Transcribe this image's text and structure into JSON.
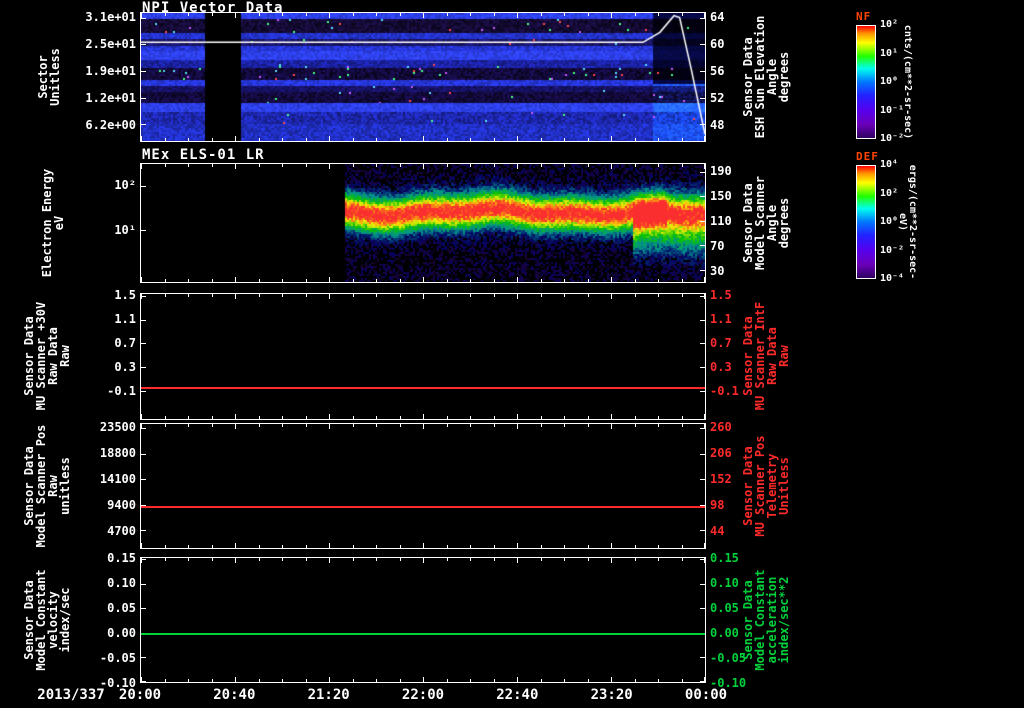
{
  "meta": {
    "background": "#000000",
    "axis_color": "#ffffff",
    "red": "#ff2a2a",
    "green": "#00d23c"
  },
  "xaxis": {
    "date_label": "2013/337",
    "tick_labels": [
      "20:00",
      "20:40",
      "21:20",
      "22:00",
      "22:40",
      "23:20",
      "00:00"
    ]
  },
  "panels": [
    {
      "title": "NPI Vector Data",
      "left_label": "Sector\nUnitless",
      "right_label": "Sensor Data\nESH Sun Elevation\nAngle\ndegrees",
      "right_color": "#ffffff",
      "left_ticks": {
        "labels": [
          "3.1e+01",
          "2.5e+01",
          "1.9e+01",
          "1.2e+01",
          "6.2e+00"
        ],
        "fracs": [
          0.038,
          0.246,
          0.454,
          0.662,
          0.869
        ]
      },
      "right_ticks": {
        "labels": [
          "64",
          "60",
          "56",
          "52",
          "48"
        ],
        "fracs": [
          0.038,
          0.246,
          0.454,
          0.662,
          0.869
        ]
      }
    },
    {
      "title": "MEx ELS-01 LR",
      "left_label": "Electron Energy\neV",
      "right_label": "Sensor Data\nModel Scanner\nAngle\ndegrees",
      "right_color": "#ffffff",
      "left_ticks": {
        "labels": [
          "10²",
          "10¹"
        ],
        "fracs": [
          0.183,
          0.558
        ]
      },
      "right_ticks": {
        "labels": [
          "190",
          "150",
          "110",
          "70",
          "30"
        ],
        "fracs": [
          0.067,
          0.275,
          0.483,
          0.69,
          0.9
        ]
      }
    },
    {
      "title": "",
      "left_label": "Sensor Data\nMU Scanner +30V\nRaw Data\nRaw",
      "right_label": "Sensor Data\nMU Scanner IntF\nRaw Data\nRaw",
      "right_color": "#ff2a2a",
      "left_ticks": {
        "labels": [
          "1.5",
          "1.1",
          "0.7",
          "0.3",
          "-0.1"
        ],
        "fracs": [
          0.016,
          0.205,
          0.394,
          0.583,
          0.772
        ]
      },
      "right_ticks": {
        "labels": [
          "1.5",
          "1.1",
          "0.7",
          "0.3",
          "-0.1"
        ],
        "fracs": [
          0.016,
          0.205,
          0.394,
          0.583,
          0.772
        ]
      }
    },
    {
      "title": "",
      "left_label": "Sensor Data\nModel Scanner Pos\nRaw\nunitless",
      "right_label": "Sensor Data\nMU Scanner Pos\nTelemetry\nUnitless",
      "right_color": "#ff2a2a",
      "left_ticks": {
        "labels": [
          "23500",
          "18800",
          "14100",
          "9400",
          "4700"
        ],
        "fracs": [
          0.032,
          0.238,
          0.444,
          0.65,
          0.856
        ]
      },
      "right_ticks": {
        "labels": [
          "260",
          "206",
          "152",
          "98",
          "44"
        ],
        "fracs": [
          0.032,
          0.238,
          0.444,
          0.65,
          0.856
        ]
      }
    },
    {
      "title": "",
      "left_label": "Sensor Data\nModel Constant\nvelocity\nindex/sec",
      "right_label": "Sensor Data\nModel Constant\nacceleration\nindex/sec**2",
      "right_color": "#00d23c",
      "left_ticks": {
        "labels": [
          "0.15",
          "0.10",
          "0.05",
          "0.00",
          "-0.05",
          "-0.10"
        ],
        "fracs": [
          0.008,
          0.206,
          0.405,
          0.603,
          0.802,
          1.0
        ]
      },
      "right_ticks": {
        "labels": [
          "0.15",
          "0.10",
          "0.05",
          "0.00",
          "-0.05",
          "-0.10"
        ],
        "fracs": [
          0.008,
          0.206,
          0.405,
          0.603,
          0.802,
          1.0
        ]
      }
    }
  ],
  "colorbars": [
    {
      "title": "NF",
      "title_color": "#ff4400",
      "unit": "cnts/(cm**2-sr-sec)",
      "tick_labels": [
        "10²",
        "10¹",
        "10⁰",
        "10⁻¹",
        "10⁻²"
      ],
      "tick_fracs": [
        0,
        0.25,
        0.5,
        0.75,
        1
      ]
    },
    {
      "title": "DEF",
      "title_color": "#ff4400",
      "unit": "ergs/(cm**2-sr-sec-eV)",
      "tick_labels": [
        "10⁴",
        "10²",
        "10⁰",
        "10⁻²",
        "10⁻⁴"
      ],
      "tick_fracs": [
        0,
        0.25,
        0.5,
        0.75,
        1
      ]
    }
  ],
  "chart_data": [
    {
      "type": "heatmap",
      "title": "NPI Vector Data",
      "ylabel": "Sector (Unitless)",
      "y_tick_values": [
        31,
        24.8,
        18.6,
        12.4,
        6.2
      ],
      "x_date": "2013/337",
      "x_ticks": [
        "20:00",
        "20:40",
        "21:20",
        "22:00",
        "22:40",
        "23:20",
        "00:00"
      ],
      "colorbar": "NF cnts/(cm**2-sr-sec), 10^2 .. 10^-2",
      "data_gap_x_frac": [
        0.112,
        0.176
      ],
      "end_anomaly_x_frac": 0.905,
      "bands": [
        {
          "y0": 0.0,
          "y1": 0.05,
          "c": "#2e41ee",
          "n": 0.25,
          "sp": 0
        },
        {
          "y0": 0.05,
          "y1": 0.16,
          "c": "#150b36",
          "n": 0.8,
          "sp": 0.02
        },
        {
          "y0": 0.16,
          "y1": 0.205,
          "c": "#2433cc",
          "n": 0.3,
          "sp": 0
        },
        {
          "y0": 0.205,
          "y1": 0.255,
          "c": "#1a1668",
          "n": 0.55,
          "sp": 0.008
        },
        {
          "y0": 0.255,
          "y1": 0.3,
          "c": "#2636d6",
          "n": 0.3,
          "sp": 0
        },
        {
          "y0": 0.3,
          "y1": 0.365,
          "c": "#2e41ee",
          "n": 0.25,
          "sp": 0
        },
        {
          "y0": 0.365,
          "y1": 0.43,
          "c": "#1b22a2",
          "n": 0.4,
          "sp": 0.004
        },
        {
          "y0": 0.43,
          "y1": 0.525,
          "c": "#130a3c",
          "n": 0.85,
          "sp": 0.018
        },
        {
          "y0": 0.525,
          "y1": 0.57,
          "c": "#2737dd",
          "n": 0.3,
          "sp": 0
        },
        {
          "y0": 0.57,
          "y1": 0.615,
          "c": "#171264",
          "n": 0.5,
          "sp": 0.006
        },
        {
          "y0": 0.615,
          "y1": 0.7,
          "c": "#130a3c",
          "n": 0.8,
          "sp": 0.012
        },
        {
          "y0": 0.7,
          "y1": 0.775,
          "c": "#2e41ee",
          "n": 0.25,
          "sp": 0
        },
        {
          "y0": 0.775,
          "y1": 0.865,
          "c": "#1d27ac",
          "n": 0.45,
          "sp": 0.006
        },
        {
          "y0": 0.865,
          "y1": 1.0,
          "c": "#2130c4",
          "n": 0.35,
          "sp": 0
        }
      ],
      "overlay_line": {
        "name": "ESH Sun Elevation Angle (degrees)",
        "color": "#ffffff",
        "axis_range": [
          45.5,
          64.7
        ],
        "points_x_frac_value": [
          [
            0,
            60.3
          ],
          [
            0.89,
            60.3
          ],
          [
            0.92,
            61.8
          ],
          [
            0.945,
            64.3
          ],
          [
            0.955,
            64.0
          ],
          [
            0.975,
            56.5
          ],
          [
            1.0,
            46.5
          ]
        ]
      }
    },
    {
      "type": "heatmap",
      "title": "MEx ELS-01 LR",
      "ylabel": "Electron Energy (eV)",
      "y_scale": "log",
      "y_tick_values": [
        100,
        10
      ],
      "x_date": "2013/337",
      "x_ticks": [
        "20:00",
        "20:40",
        "21:20",
        "22:00",
        "22:40",
        "23:20",
        "00:00"
      ],
      "colorbar": "DEF ergs/(cm**2-sr-sec-eV), 10^4 .. 10^-4",
      "data_start_x_frac": 0.36,
      "band": {
        "center_frac": 0.4,
        "sigma_frac": 0.105,
        "peak": 1.05,
        "wiggle": [
          0.022,
          18,
          0.013,
          47
        ],
        "plume": {
          "x0": 0.87,
          "x1": 1.0,
          "center_offset": 0.18,
          "sigma": 0.14,
          "peak": 0.5
        },
        "fade": {
          "x0": 0.93,
          "x1": 1.0,
          "factor": 0.75
        }
      }
    },
    {
      "type": "line",
      "ylabel": "Sensor Data MU Scanner +30V Raw Data Raw",
      "right_label": "Sensor Data MU Scanner IntF Raw Data Raw",
      "ylim": [
        -0.26,
        1.53
      ],
      "x_ticks": [
        "20:00",
        "20:40",
        "21:20",
        "22:00",
        "22:40",
        "23:20",
        "00:00"
      ],
      "series": [
        {
          "name": "MU Scanner Raw",
          "color": "#ff2a2a",
          "constant_value": 0.05,
          "y_frac": 0.74
        }
      ]
    },
    {
      "type": "line",
      "ylabel": "Sensor Data Model Scanner Pos Raw unitless",
      "right_label": "Sensor Data MU Scanner Pos Telemetry Unitless",
      "ylim": [
        4000,
        24200
      ],
      "x_ticks": [
        "20:00",
        "20:40",
        "21:20",
        "22:00",
        "22:40",
        "23:20",
        "00:00"
      ],
      "series": [
        {
          "name": "Model Scanner Pos Raw",
          "color": "#ff2a2a",
          "constant_value": 9200,
          "y_frac": 0.66
        }
      ]
    },
    {
      "type": "line",
      "ylabel": "Sensor Data Model Constant velocity index/sec",
      "right_label": "Sensor Data Model Constant acceleration index/sec**2",
      "ylim": [
        -0.1,
        0.15
      ],
      "x_ticks": [
        "20:00",
        "20:40",
        "21:20",
        "22:00",
        "22:40",
        "23:20",
        "00:00"
      ],
      "series": [
        {
          "name": "Model Constant velocity",
          "color": "#00d23c",
          "constant_value": 0.0,
          "y_frac": 0.603
        }
      ]
    }
  ]
}
